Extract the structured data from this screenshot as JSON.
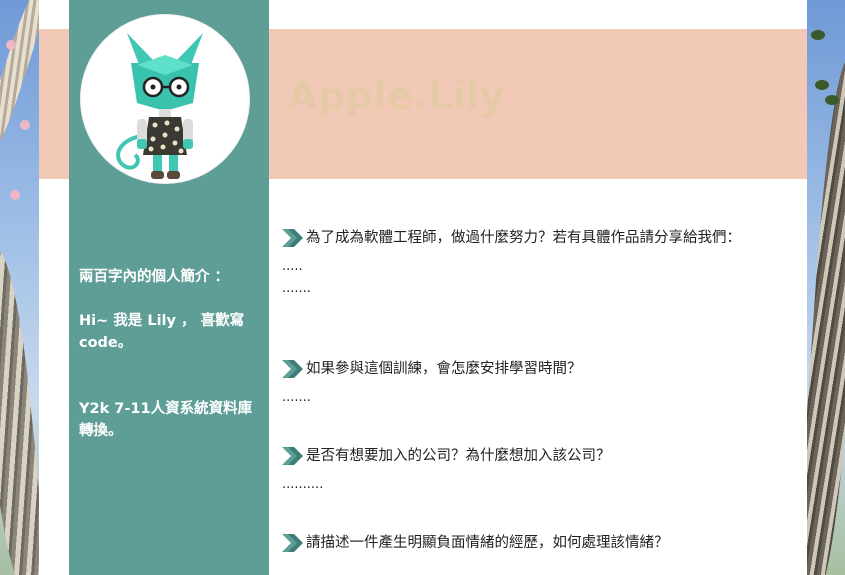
{
  "profile": {
    "name": "Apple.Lily",
    "bio_heading": "兩百字內的個人簡介 ：",
    "bio_intro": "Hi~ 我是 Lily ， 喜歡寫code。",
    "bio_class": "Y2k 7-11人資系統資料庫轉換。"
  },
  "qa": [
    {
      "question": "為了成為軟體工程師，做過什麼努力？若有具體作品請分享給我們：",
      "answers": [
        ".....",
        "......."
      ]
    },
    {
      "question": "如果參與這個訓練，會怎麼安排學習時間？",
      "answers": [
        "......."
      ]
    },
    {
      "question": "是否有想要加入的公司？為什麼想加入該公司？",
      "answers": [
        ".........."
      ]
    },
    {
      "question": "請描述一件產生明顯負面情緒的經歷，如何處理該情緒？",
      "answers": []
    }
  ],
  "colors": {
    "sidebar": "#5e9e97",
    "header_band": "#f2c8b6",
    "title": "#e6c9a6",
    "arrow": "#5e9e97"
  },
  "icons": {
    "bullet": "double-chevron-right-icon",
    "avatar": "cat-robot-avatar"
  }
}
